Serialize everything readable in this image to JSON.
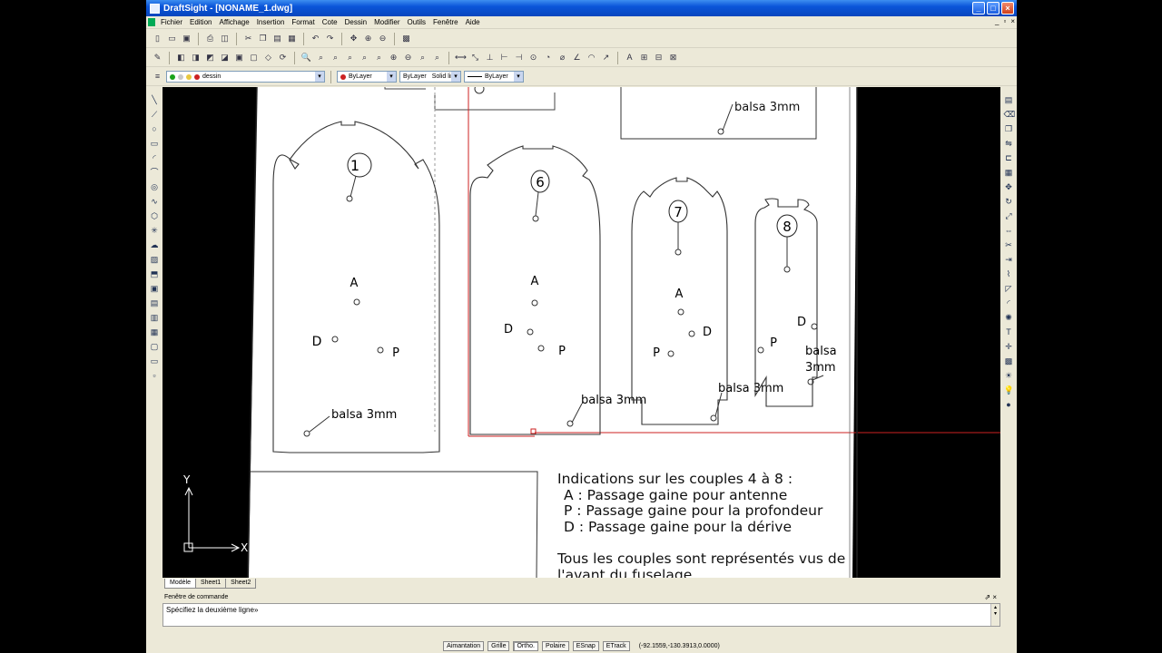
{
  "window": {
    "title": "DraftSight - [NONAME_1.dwg]"
  },
  "menubar": {
    "items": [
      "Fichier",
      "Edition",
      "Affichage",
      "Insertion",
      "Format",
      "Cote",
      "Dessin",
      "Modifier",
      "Outils",
      "Fenêtre",
      "Aide"
    ]
  },
  "layer_toolbar": {
    "layer": "dessin",
    "color": "ByLayer",
    "linestyle": "ByLayer",
    "linestyle_name": "Solid line",
    "lineweight": "ByLayer"
  },
  "drawing": {
    "parts": [
      {
        "number": "1",
        "letters": [
          "A",
          "D",
          "P"
        ],
        "note": "balsa 3mm"
      },
      {
        "number": "6",
        "letters": [
          "A",
          "D",
          "P"
        ],
        "note": "balsa 3mm"
      },
      {
        "number": "7",
        "letters": [
          "A",
          "D",
          "P"
        ],
        "note": "balsa 3mm"
      },
      {
        "number": "8",
        "letters": [
          "D",
          "P"
        ],
        "note_line1": "balsa",
        "note_line2": "3mm"
      }
    ],
    "top_note": "balsa 3mm",
    "instructions": [
      "Indications sur les couples 4 à 8 :",
      "A : Passage gaine pour antenne",
      "P : Passage gaine pour la profondeur",
      "D : Passage gaine pour la dérive",
      "Tous les couples sont représentés vus de",
      "l'avant du fuselage"
    ],
    "axis_x": "X",
    "axis_y": "Y"
  },
  "tabs": [
    "Modèle",
    "Sheet1",
    "Sheet2"
  ],
  "command": {
    "header": "Fenêtre de commande",
    "prompt": "Spécifiez la deuxième ligne»"
  },
  "statusbar": {
    "buttons": [
      "Aimantation",
      "Grille",
      "Ortho.",
      "Polaire",
      "ESnap",
      "ETrack"
    ],
    "coords": "(-92.1559,-130.3913,0.0000)"
  },
  "colors": {
    "accent_red": "#cc2222",
    "title_blue": "#0a55d9"
  }
}
